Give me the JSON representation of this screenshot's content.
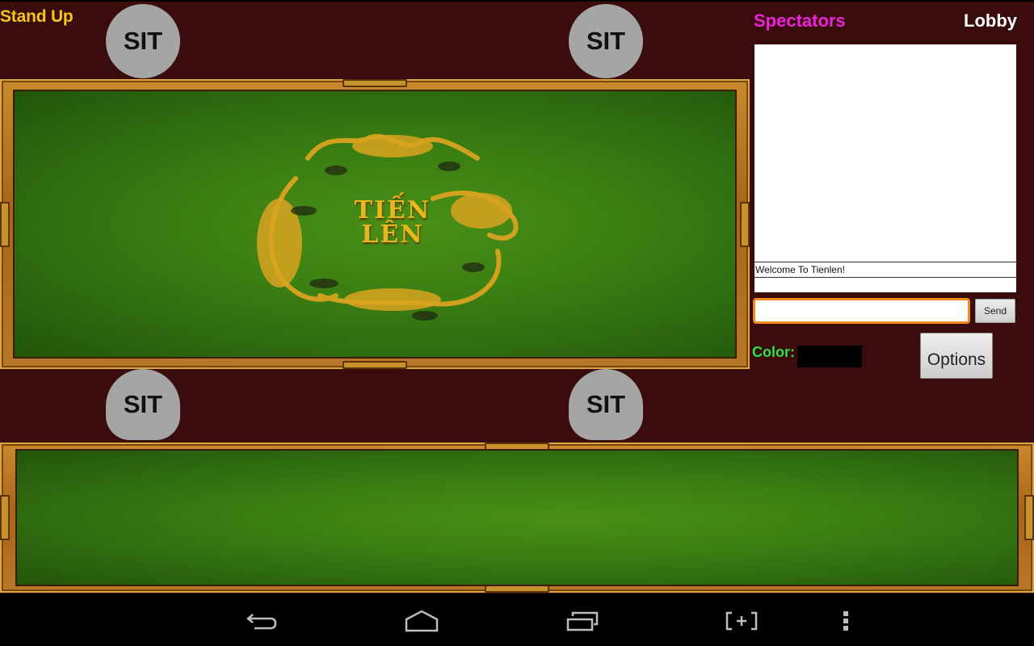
{
  "header": {
    "stand_up_label": "Stand Up",
    "spectators_label": "Spectators",
    "lobby_label": "Lobby"
  },
  "seats": {
    "top_left": "SIT",
    "top_right": "SIT",
    "bottom_left": "SIT",
    "bottom_right": "SIT"
  },
  "table": {
    "logo_line1": "TIẾN",
    "logo_line2": "LÊN",
    "logo_icon": "dragon-tiger-phoenix-turtle-emblem"
  },
  "chat": {
    "messages": [
      "Welcome To Tienlen!"
    ],
    "input_value": "",
    "input_placeholder": "",
    "send_label": "Send"
  },
  "color": {
    "label": "Color:",
    "selected_color": "#000000"
  },
  "options_label": "Options",
  "navbar": {
    "icons": [
      "back-icon",
      "home-icon",
      "recent-apps-icon",
      "screenshot-icon",
      "overflow-menu-icon"
    ]
  },
  "colors": {
    "background": "#3a0c0c",
    "stand_up": "#f5c518",
    "spectators": "#ee22dd",
    "lobby": "#ffffff",
    "color_label": "#2ee04a",
    "felt": "#3b7e12",
    "frame": "#b9772a",
    "input_focus": "#f08a1c"
  }
}
